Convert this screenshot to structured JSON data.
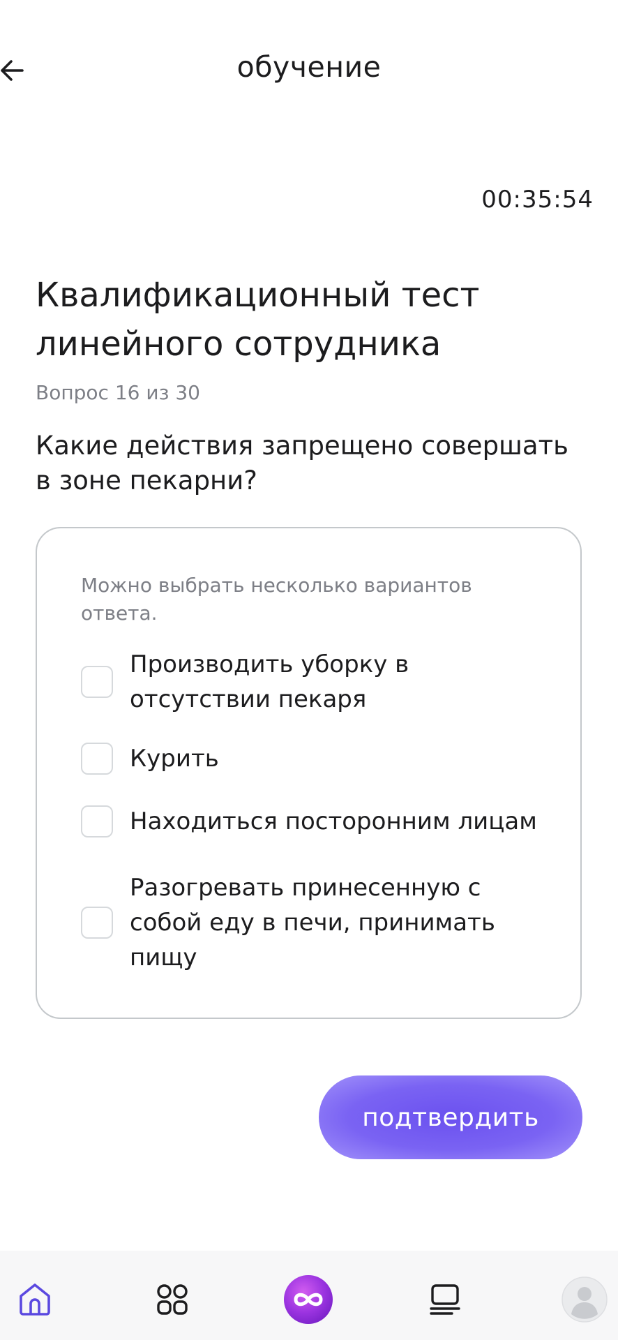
{
  "header": {
    "title": "обучение",
    "back_icon": "arrow-left-icon"
  },
  "timer": "00:35:54",
  "test": {
    "title": "Квалификационный тест линейного сотрудника",
    "question_counter": "Вопрос 16 из 30",
    "question": "Какие действия запрещено совершать в зоне пекарни?"
  },
  "answers": {
    "hint": "Можно выбрать несколько вариантов ответа.",
    "options": [
      {
        "label": "Производить уборку в отсутствии пекаря",
        "checked": false
      },
      {
        "label": "Курить",
        "checked": false
      },
      {
        "label": "Находиться посторонним лицам",
        "checked": false
      },
      {
        "label": "Разогревать принесенную с собой еду в печи, принимать пищу",
        "checked": false
      }
    ]
  },
  "confirm_label": "подтвердить",
  "bottom_nav": {
    "items": [
      "home-icon",
      "grid-icon",
      "infinity-logo-icon",
      "courses-icon",
      "profile-avatar-icon"
    ],
    "active": "home-icon"
  },
  "colors": {
    "accent": "#6b51ef",
    "nav_active": "#5b49e0",
    "text": "#1c1c1e",
    "muted": "#7d7f86",
    "border": "#c4c8cb"
  }
}
